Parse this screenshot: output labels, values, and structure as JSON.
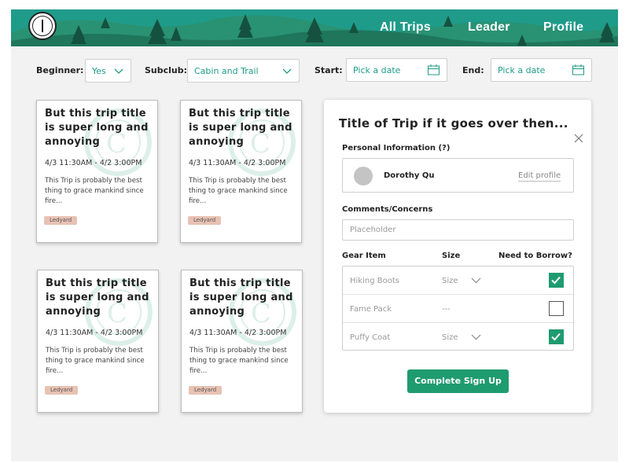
{
  "nav": {
    "all_trips": "All Trips",
    "leader": "Leader",
    "profile": "Profile"
  },
  "filters": {
    "beginner_label": "Beginner:",
    "beginner_value": "Yes",
    "subclub_label": "Subclub:",
    "subclub_value": "Cabin and Trail",
    "start_label": "Start:",
    "start_placeholder": "Pick a date",
    "end_label": "End:",
    "end_placeholder": "Pick a date"
  },
  "trips": [
    {
      "title": "But this trip title is super long and annoying",
      "time": "4/3 11:30AM - 4/2 3:00PM",
      "description": "This Trip is probably the best thing to grace mankind since fire...",
      "tag": "Ledyard"
    },
    {
      "title": "But this trip title is super long and annoying",
      "time": "4/3 11:30AM - 4/2 3:00PM",
      "description": "This Trip is probably the best thing to grace mankind since fire...",
      "tag": "Ledyard"
    },
    {
      "title": "But this trip title is super long and annoying",
      "time": "4/3 11:30AM - 4/2 3:00PM",
      "description": "This Trip is probably the best thing to grace mankind since fire...",
      "tag": "Ledyard"
    },
    {
      "title": "But this trip title is super long and annoying",
      "time": "4/3 11:30AM - 4/2 3:00PM",
      "description": "This Trip is probably the best thing to grace mankind since fire...",
      "tag": "Ledyard"
    }
  ],
  "signup": {
    "title": "Title of Trip if it goes over then...",
    "personal_info_label": "Personal Information (?)",
    "user_name": "Dorothy Qu",
    "edit_profile": "Edit profile",
    "comments_label": "Comments/Concerns",
    "comments_placeholder": "Placeholder",
    "gear_col_item": "Gear Item",
    "gear_col_size": "Size",
    "gear_col_borrow": "Need to Borrow?",
    "gear": [
      {
        "name": "Hiking Boots",
        "size": "Size",
        "has_dropdown": true,
        "borrow": true
      },
      {
        "name": "Fame Pack",
        "size": "---",
        "has_dropdown": false,
        "borrow": false
      },
      {
        "name": "Puffy Coat",
        "size": "Size",
        "has_dropdown": true,
        "borrow": true
      }
    ],
    "submit": "Complete Sign Up"
  },
  "colors": {
    "header": "#1f9b8a",
    "accent": "#1f9b70",
    "tag": "#e8c2b3"
  },
  "icons": [
    "logo-icon",
    "chevron-down-icon",
    "calendar-icon",
    "close-icon",
    "checkmark-icon",
    "tree-icon"
  ]
}
